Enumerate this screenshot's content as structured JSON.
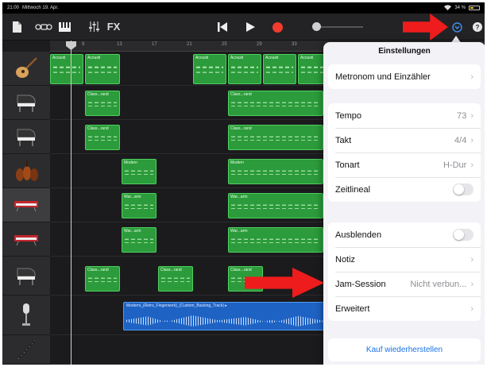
{
  "status_bar": {
    "time": "21:00",
    "date": "Mittwoch 19. Apr.",
    "battery": "34 %"
  },
  "toolbar": {
    "fx_label": "FX"
  },
  "ruler": {
    "marks": [
      "9",
      "13",
      "17",
      "21",
      "25",
      "29",
      "33"
    ]
  },
  "tracks": [
    {
      "icon": "acoustic-guitar-icon",
      "regions": [
        "Acousti",
        "Acousti",
        "Acousti",
        "Acousti",
        "Acousti",
        "Acousti"
      ]
    },
    {
      "icon": "grand-piano-icon",
      "regions": [
        "Class...rand",
        "Class...rand"
      ]
    },
    {
      "icon": "grand-piano-icon",
      "regions": [
        "Class...rand",
        "Class...rand"
      ]
    },
    {
      "icon": "strings-icon",
      "regions": [
        "Modern",
        "Modern"
      ]
    },
    {
      "icon": "synth-keyboard-icon",
      "regions": [
        "War...arm",
        "War...arm"
      ]
    },
    {
      "icon": "synth-keyboard-icon",
      "regions": [
        "War...arm",
        "War...arm"
      ]
    },
    {
      "icon": "grand-piano-icon",
      "regions": [
        "Class...rand",
        "Class...rand",
        "Class...rand"
      ]
    },
    {
      "icon": "microphone-icon",
      "regions": [
        "Moderni_(Retro_Fingerwork)_(Custom_Backing_Track) ▸"
      ]
    },
    {
      "icon": "clarinet-icon",
      "regions": []
    }
  ],
  "settings": {
    "title": "Einstellungen",
    "metronome": "Metronom und Einzähler",
    "tempo_label": "Tempo",
    "tempo_value": "73",
    "takt_label": "Takt",
    "takt_value": "4/4",
    "tonart_label": "Tonart",
    "tonart_value": "H-Dur",
    "zeitlineal_label": "Zeitlineal",
    "zeitlineal_on": false,
    "ausblenden_label": "Ausblenden",
    "ausblenden_on": false,
    "notiz_label": "Notiz",
    "jam_label": "Jam-Session",
    "jam_value": "Nicht verbun...",
    "erweitert_label": "Erweitert",
    "restore_label": "Kauf wiederherstellen"
  },
  "colors": {
    "accent": "#1a73e8",
    "midi_region": "#2c9b3b",
    "audio_region": "#1e63c4",
    "record": "#f23b2f",
    "annotation_arrow": "#ee1c1c"
  }
}
